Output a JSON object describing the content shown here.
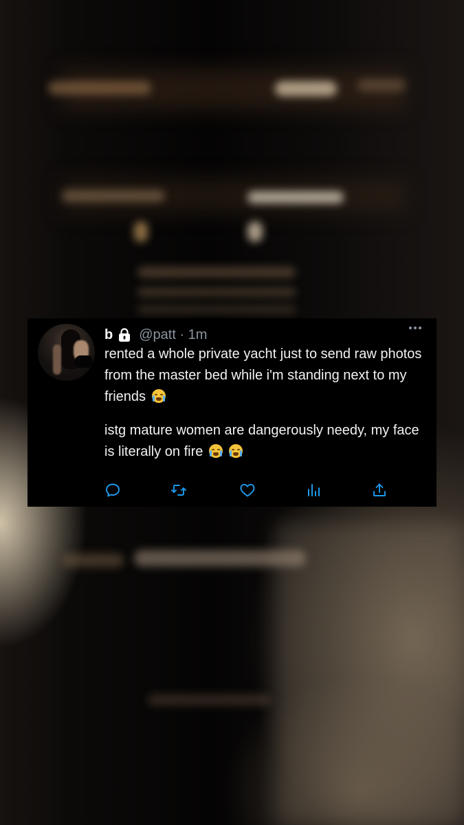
{
  "tweet": {
    "display_name": "b",
    "handle_time": "@patt · 1m",
    "paragraphs": [
      "rented a whole private yacht just to send raw photos from the master bed while i'm standing next to my friends",
      "istg mature women are dangerously needy, my face is literally on fire"
    ],
    "icons": {
      "verified_lock": "lock-icon",
      "avatar": "profile-photo",
      "more": "more-options-icon",
      "emoji": "loudly-crying-face-emoji"
    }
  },
  "actions": [
    {
      "name": "reply",
      "icon": "reply-icon"
    },
    {
      "name": "retweet",
      "icon": "retweet-icon"
    },
    {
      "name": "like",
      "icon": "heart-icon"
    },
    {
      "name": "analytics",
      "icon": "analytics-icon"
    },
    {
      "name": "share",
      "icon": "share-icon"
    }
  ],
  "colors": {
    "card_background": "#000000",
    "text": "#f2f2f2",
    "secondary_text": "#8b949e",
    "action_icon": "#1d9bf0"
  }
}
